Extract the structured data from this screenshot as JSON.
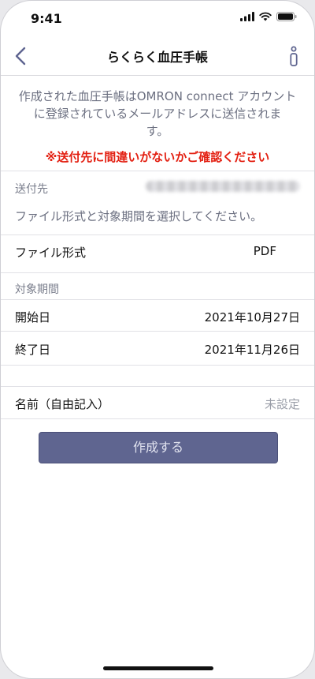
{
  "status_bar": {
    "time": "9:41",
    "signal_icon": "cellular-signal-icon",
    "wifi_icon": "wifi-icon",
    "battery_icon": "battery-icon"
  },
  "nav": {
    "title": "らくらく血圧手帳",
    "back_icon": "chevron-left-icon",
    "info_icon": "info-icon"
  },
  "notice": {
    "line1": "作成された血圧手帳はOMRON connect アカウント",
    "line2": "に登録されているメールアドレスに送信されま",
    "line3": "す。",
    "warning": "※送付先に間違いがないかご確認ください"
  },
  "recipient": {
    "label": "送付先"
  },
  "instruction": "ファイル形式と対象期間を選択してください。",
  "file_format": {
    "label": "ファイル形式",
    "value": "PDF"
  },
  "period": {
    "header": "対象期間",
    "start_label": "開始日",
    "start_value": "2021年10月27日",
    "end_label": "終了日",
    "end_value": "2021年11月26日"
  },
  "name_field": {
    "label": "名前（自由記入）",
    "placeholder": "未設定"
  },
  "create_button": {
    "label": "作成する"
  },
  "colors": {
    "accent": "#5f6590",
    "warning": "#e32012",
    "muted_text": "#6b6f80"
  }
}
